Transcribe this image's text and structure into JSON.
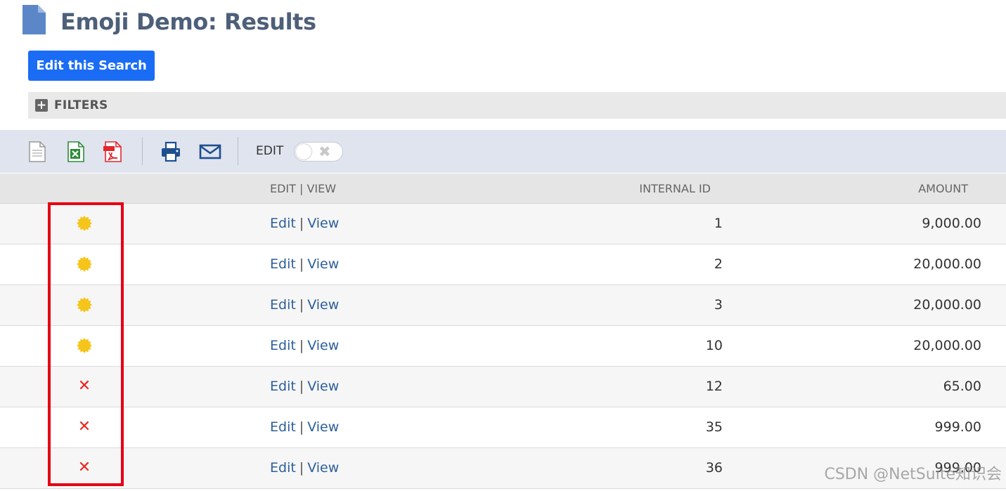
{
  "page": {
    "title": "Emoji Demo: Results",
    "icon": "document-icon"
  },
  "actions": {
    "edit_search_label": "Edit this Search"
  },
  "filters": {
    "label": "FILTERS",
    "icon": "plus-box-icon"
  },
  "toolbar": {
    "icons": [
      "export-csv-icon",
      "export-excel-icon",
      "export-pdf-icon",
      "print-icon",
      "email-icon"
    ],
    "edit_label": "EDIT",
    "edit_toggle_on": false
  },
  "table": {
    "headers": {
      "status": "",
      "edit_view": "EDIT | VIEW",
      "internal_id": "INTERNAL ID",
      "amount": "AMOUNT"
    },
    "rows": [
      {
        "status": "warning",
        "edit": "Edit",
        "view": "View",
        "internal_id": "1",
        "amount": "9,000.00"
      },
      {
        "status": "warning",
        "edit": "Edit",
        "view": "View",
        "internal_id": "2",
        "amount": "20,000.00"
      },
      {
        "status": "warning",
        "edit": "Edit",
        "view": "View",
        "internal_id": "3",
        "amount": "20,000.00"
      },
      {
        "status": "warning",
        "edit": "Edit",
        "view": "View",
        "internal_id": "10",
        "amount": "20,000.00"
      },
      {
        "status": "error",
        "edit": "Edit",
        "view": "View",
        "internal_id": "12",
        "amount": "65.00"
      },
      {
        "status": "error",
        "edit": "Edit",
        "view": "View",
        "internal_id": "35",
        "amount": "999.00"
      },
      {
        "status": "error",
        "edit": "Edit",
        "view": "View",
        "internal_id": "36",
        "amount": "999.00"
      }
    ]
  },
  "colors": {
    "primary_button": "#1a6cf5",
    "title": "#4d5f79",
    "link": "#2c5e9c",
    "warning": "#f5c51b",
    "error": "#e8261f",
    "highlight": "#e60012"
  },
  "watermark": "CSDN @NetSuite知识会"
}
